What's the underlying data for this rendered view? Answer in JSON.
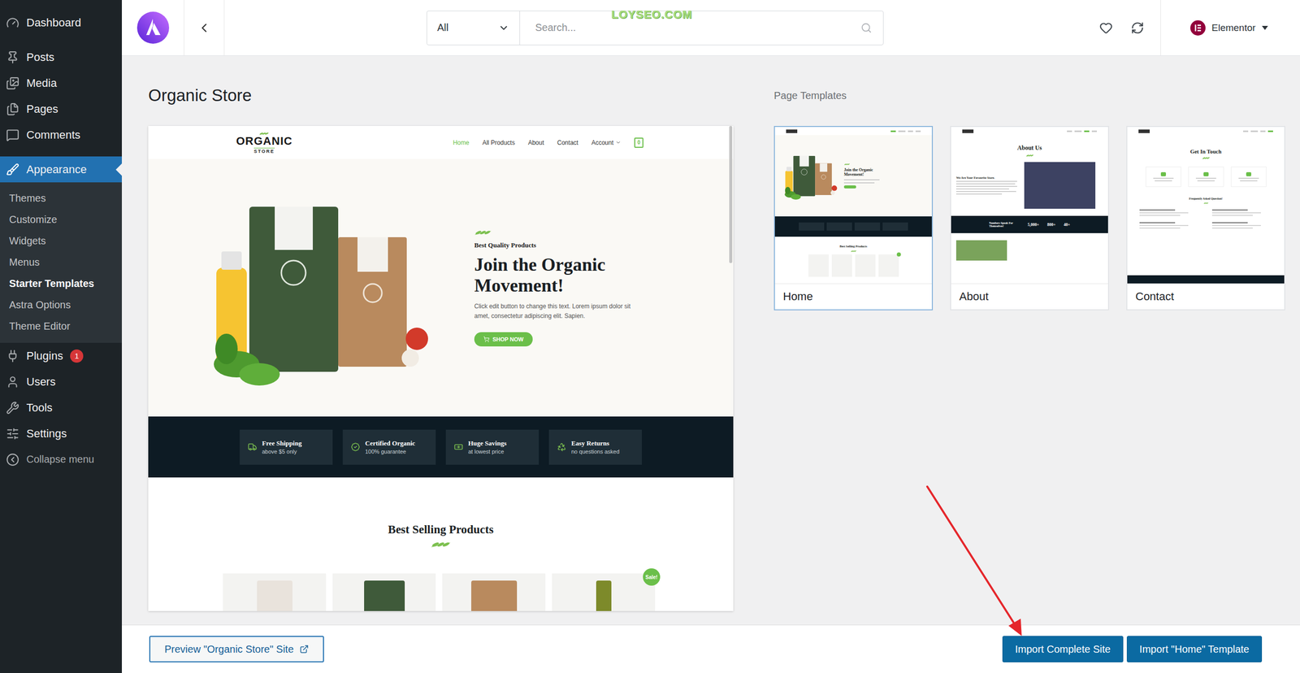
{
  "watermark": "LOYSEO.COM",
  "sidebar": {
    "items": [
      {
        "label": "Dashboard",
        "selected": false,
        "badge": ""
      },
      {
        "label": "Posts",
        "selected": false,
        "badge": ""
      },
      {
        "label": "Media",
        "selected": false,
        "badge": ""
      },
      {
        "label": "Pages",
        "selected": false,
        "badge": ""
      },
      {
        "label": "Comments",
        "selected": false,
        "badge": ""
      },
      {
        "label": "Appearance",
        "selected": true,
        "badge": "",
        "expanded": true,
        "submenu": [
          {
            "label": "Themes",
            "selected": false
          },
          {
            "label": "Customize",
            "selected": false
          },
          {
            "label": "Widgets",
            "selected": false
          },
          {
            "label": "Menus",
            "selected": false
          },
          {
            "label": "Starter Templates",
            "selected": true
          },
          {
            "label": "Astra Options",
            "selected": false
          },
          {
            "label": "Theme Editor",
            "selected": false
          }
        ]
      },
      {
        "label": "Plugins",
        "selected": false,
        "badge": "1"
      },
      {
        "label": "Users",
        "selected": false,
        "badge": ""
      },
      {
        "label": "Tools",
        "selected": false,
        "badge": ""
      },
      {
        "label": "Settings",
        "selected": false,
        "badge": ""
      }
    ],
    "collapse": "Collapse menu"
  },
  "topbar": {
    "filter": "All",
    "search_placeholder": "Search...",
    "builder": "Elementor"
  },
  "title": "Organic Store",
  "preview": {
    "logo": "ORGANIC",
    "logo_sub": "STORE",
    "nav": [
      {
        "label": "Home",
        "selected": true,
        "dropdown": false
      },
      {
        "label": "All Products",
        "selected": false,
        "dropdown": false
      },
      {
        "label": "About",
        "selected": false,
        "dropdown": false
      },
      {
        "label": "Contact",
        "selected": false,
        "dropdown": false
      },
      {
        "label": "Account",
        "selected": false,
        "dropdown": true
      }
    ],
    "cart_count": "0",
    "hero": {
      "eyebrow": "Best Quality Products",
      "headline": "Join the Organic Movement!",
      "body": "Click edit button to change this text. Lorem ipsum dolor sit amet, consectetur adipiscing elit. Sapien.",
      "button": "SHOP NOW"
    },
    "features": [
      {
        "title": "Free Shipping",
        "subtitle": "above $5 only"
      },
      {
        "title": "Certified Organic",
        "subtitle": "100% guarantee"
      },
      {
        "title": "Huge Savings",
        "subtitle": "at lowest price"
      },
      {
        "title": "Easy Returns",
        "subtitle": "no questions asked"
      }
    ],
    "section_title": "Best Selling Products",
    "products": [
      {
        "badge": ""
      },
      {
        "badge": ""
      },
      {
        "badge": ""
      },
      {
        "badge": "Sale!"
      }
    ]
  },
  "page_templates": {
    "label": "Page Templates",
    "cards": [
      {
        "label": "Home",
        "selected": true,
        "kind": "home",
        "headline": "Join the Organic Movement!",
        "section": "Best Selling Products"
      },
      {
        "label": "About",
        "selected": false,
        "kind": "about",
        "heading": "About Us",
        "subheading": "We Are Your Favourite Store.",
        "band_title": "Numbers Speak For Themselves!",
        "stats": [
          "5,000+",
          "800+",
          "40+"
        ]
      },
      {
        "label": "Contact",
        "selected": false,
        "kind": "contact",
        "heading": "Get In Touch",
        "section": "Frequently Asked Question!"
      }
    ]
  },
  "footer": {
    "preview_button": "Preview \"Organic Store\" Site",
    "buttons": [
      "Import Complete Site",
      "Import \"Home\" Template"
    ]
  }
}
